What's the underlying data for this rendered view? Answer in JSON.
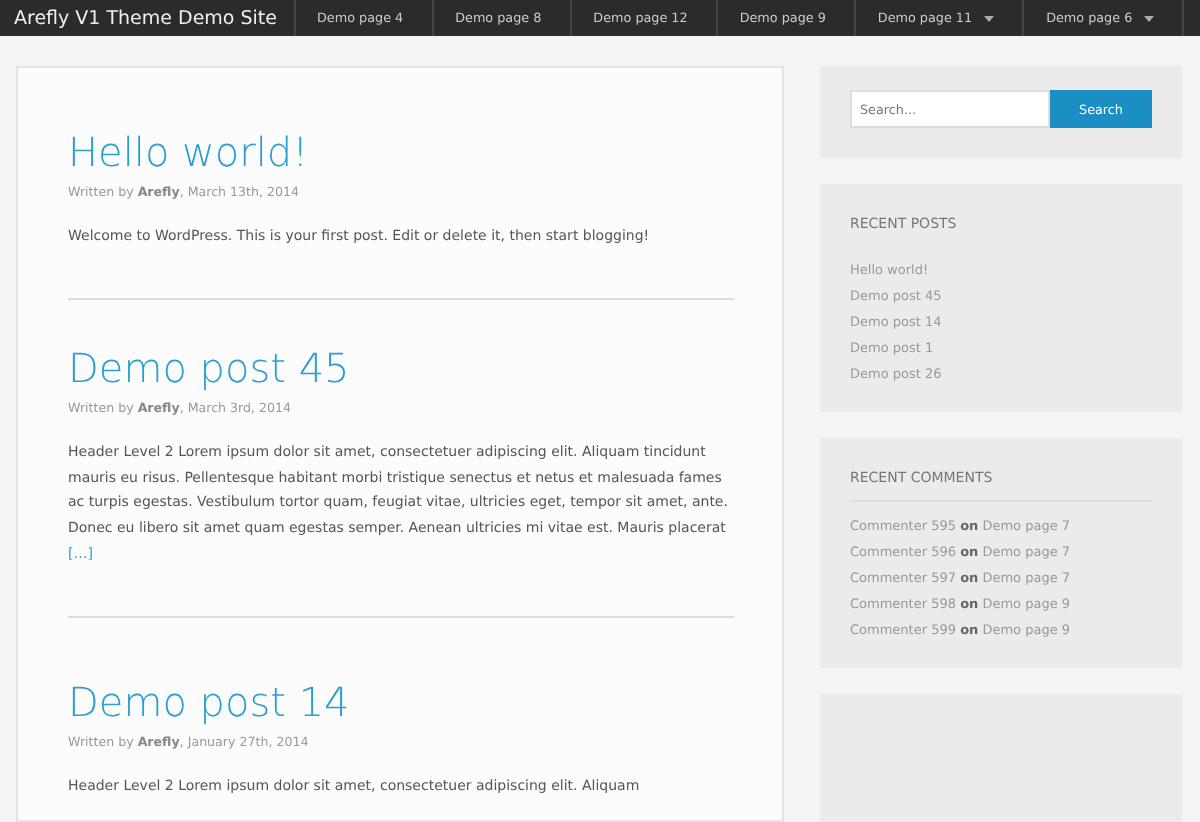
{
  "site_title": "Arefly V1 Theme Demo Site",
  "nav": [
    {
      "label": "Demo page 4",
      "has_submenu": false
    },
    {
      "label": "Demo page 8",
      "has_submenu": false
    },
    {
      "label": "Demo page 12",
      "has_submenu": false
    },
    {
      "label": "Demo page 9",
      "has_submenu": false
    },
    {
      "label": "Demo page 11",
      "has_submenu": true
    },
    {
      "label": "Demo page 6",
      "has_submenu": true
    }
  ],
  "posts": [
    {
      "title": "Hello world!",
      "meta": "Written by **Arefly**, March 13th, 2014",
      "excerpt": "Welcome to WordPress. This is your first post. Edit or delete it, then start blogging!"
    },
    {
      "title": "Demo post 45",
      "meta": "Written by **Arefly**, March 3rd, 2014",
      "excerpt": "Header Level 2 Lorem ipsum dolor sit amet, consectetuer adipiscing elit. Aliquam tincidunt mauris eu risus. Pellentesque habitant morbi tristique senectus et netus et malesuada fames ac turpis egestas. Vestibulum tortor quam, feugiat vitae, ultricies eget, tempor sit amet, ante. Donec eu libero sit amet quam egestas semper. Aenean ultricies mi vitae est. Mauris placerat",
      "more": "[…]"
    },
    {
      "title": "Demo post 14",
      "meta": "Written by **Arefly**, January 27th, 2014",
      "excerpt": "Header Level 2 Lorem ipsum dolor sit amet, consectetuer adipiscing elit. Aliquam"
    }
  ],
  "sidebar": {
    "search": {
      "placeholder": "Search...",
      "button": "Search"
    },
    "widgets": [
      {
        "title": "RECENT POSTS",
        "items": [
          "Hello world!",
          "Demo post 45",
          "Demo post 14",
          "Demo post 1",
          "Demo post 26"
        ]
      },
      {
        "title": "RECENT COMMENTS",
        "items": [
          "Commenter 595 **on** Demo page 7",
          "Commenter 596 **on** Demo page 7",
          "Commenter 597 **on** Demo page 7",
          "Commenter 598 **on** Demo page 9",
          "Commenter 599 **on** Demo page 9"
        ]
      }
    ]
  }
}
